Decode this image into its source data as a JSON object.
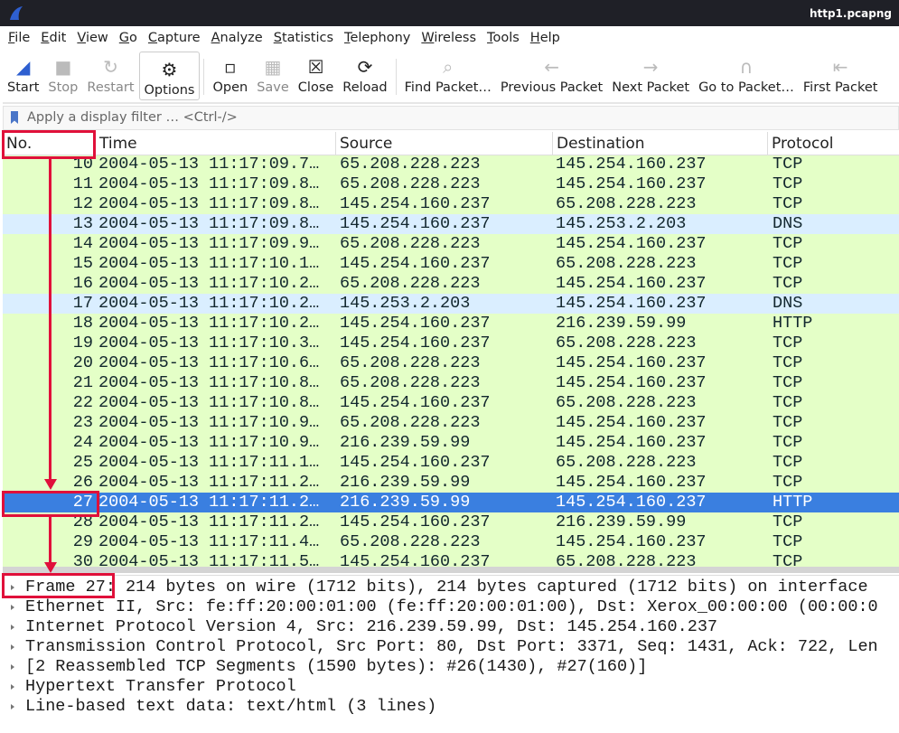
{
  "window": {
    "title": "http1.pcapng"
  },
  "menu": [
    "File",
    "Edit",
    "View",
    "Go",
    "Capture",
    "Analyze",
    "Statistics",
    "Telephony",
    "Wireless",
    "Tools",
    "Help"
  ],
  "toolbar": [
    {
      "label": "Start",
      "icon": "shark-fin-icon",
      "enabled": true
    },
    {
      "label": "Stop",
      "icon": "stop-icon",
      "enabled": false
    },
    {
      "label": "Restart",
      "icon": "restart-icon",
      "enabled": false
    },
    {
      "label": "Options",
      "icon": "gear-icon",
      "enabled": true
    },
    {
      "label": "Open",
      "icon": "open-file-icon",
      "enabled": true
    },
    {
      "label": "Save",
      "icon": "save-icon",
      "enabled": false
    },
    {
      "label": "Close",
      "icon": "close-file-icon",
      "enabled": true
    },
    {
      "label": "Reload",
      "icon": "reload-icon",
      "enabled": true
    },
    {
      "label": "Find Packet…",
      "icon": "search-icon",
      "enabled": true
    },
    {
      "label": "Previous Packet",
      "icon": "arrow-left-icon",
      "enabled": true
    },
    {
      "label": "Next Packet",
      "icon": "arrow-right-icon",
      "enabled": true
    },
    {
      "label": "Go to Packet…",
      "icon": "jump-icon",
      "enabled": true
    },
    {
      "label": "First Packet",
      "icon": "first-icon",
      "enabled": true
    }
  ],
  "filter": {
    "placeholder": "Apply a display filter … <Ctrl-/>"
  },
  "columns": [
    "No.",
    "Time",
    "Source",
    "Destination",
    "Protocol"
  ],
  "colors": {
    "tcp": "#e4ffc7",
    "dns": "#daeeff",
    "http": "#e4ffc7",
    "selected": "#3a7fe0",
    "annotation": "#e0103a"
  },
  "packets": [
    [
      "10",
      "2004-05-13 11:17:09.7…",
      "65.208.228.223",
      "145.254.160.237",
      "TCP"
    ],
    [
      "11",
      "2004-05-13 11:17:09.8…",
      "65.208.228.223",
      "145.254.160.237",
      "TCP"
    ],
    [
      "12",
      "2004-05-13 11:17:09.8…",
      "145.254.160.237",
      "65.208.228.223",
      "TCP"
    ],
    [
      "13",
      "2004-05-13 11:17:09.8…",
      "145.254.160.237",
      "145.253.2.203",
      "DNS"
    ],
    [
      "14",
      "2004-05-13 11:17:09.9…",
      "65.208.228.223",
      "145.254.160.237",
      "TCP"
    ],
    [
      "15",
      "2004-05-13 11:17:10.1…",
      "145.254.160.237",
      "65.208.228.223",
      "TCP"
    ],
    [
      "16",
      "2004-05-13 11:17:10.2…",
      "65.208.228.223",
      "145.254.160.237",
      "TCP"
    ],
    [
      "17",
      "2004-05-13 11:17:10.2…",
      "145.253.2.203",
      "145.254.160.237",
      "DNS"
    ],
    [
      "18",
      "2004-05-13 11:17:10.2…",
      "145.254.160.237",
      "216.239.59.99",
      "HTTP"
    ],
    [
      "19",
      "2004-05-13 11:17:10.3…",
      "145.254.160.237",
      "65.208.228.223",
      "TCP"
    ],
    [
      "20",
      "2004-05-13 11:17:10.6…",
      "65.208.228.223",
      "145.254.160.237",
      "TCP"
    ],
    [
      "21",
      "2004-05-13 11:17:10.8…",
      "65.208.228.223",
      "145.254.160.237",
      "TCP"
    ],
    [
      "22",
      "2004-05-13 11:17:10.8…",
      "145.254.160.237",
      "65.208.228.223",
      "TCP"
    ],
    [
      "23",
      "2004-05-13 11:17:10.9…",
      "65.208.228.223",
      "145.254.160.237",
      "TCP"
    ],
    [
      "24",
      "2004-05-13 11:17:10.9…",
      "216.239.59.99",
      "145.254.160.237",
      "TCP"
    ],
    [
      "25",
      "2004-05-13 11:17:11.1…",
      "145.254.160.237",
      "65.208.228.223",
      "TCP"
    ],
    [
      "26",
      "2004-05-13 11:17:11.2…",
      "216.239.59.99",
      "145.254.160.237",
      "TCP"
    ],
    [
      "27",
      "2004-05-13 11:17:11.2…",
      "216.239.59.99",
      "145.254.160.237",
      "HTTP"
    ],
    [
      "28",
      "2004-05-13 11:17:11.2…",
      "145.254.160.237",
      "216.239.59.99",
      "TCP"
    ],
    [
      "29",
      "2004-05-13 11:17:11.4…",
      "65.208.228.223",
      "145.254.160.237",
      "TCP"
    ],
    [
      "30",
      "2004-05-13 11:17:11.5…",
      "145.254.160.237",
      "65.208.228.223",
      "TCP"
    ]
  ],
  "selected_packet": "27",
  "details": [
    "Frame 27: 214 bytes on wire (1712 bits), 214 bytes captured (1712 bits) on interface",
    "Ethernet II, Src: fe:ff:20:00:01:00 (fe:ff:20:00:01:00), Dst: Xerox_00:00:00 (00:00:0",
    "Internet Protocol Version 4, Src: 216.239.59.99, Dst: 145.254.160.237",
    "Transmission Control Protocol, Src Port: 80, Dst Port: 3371, Seq: 1431, Ack: 722, Len",
    "[2 Reassembled TCP Segments (1590 bytes): #26(1430), #27(160)]",
    "Hypertext Transfer Protocol",
    "Line-based text data: text/html (3 lines)"
  ]
}
